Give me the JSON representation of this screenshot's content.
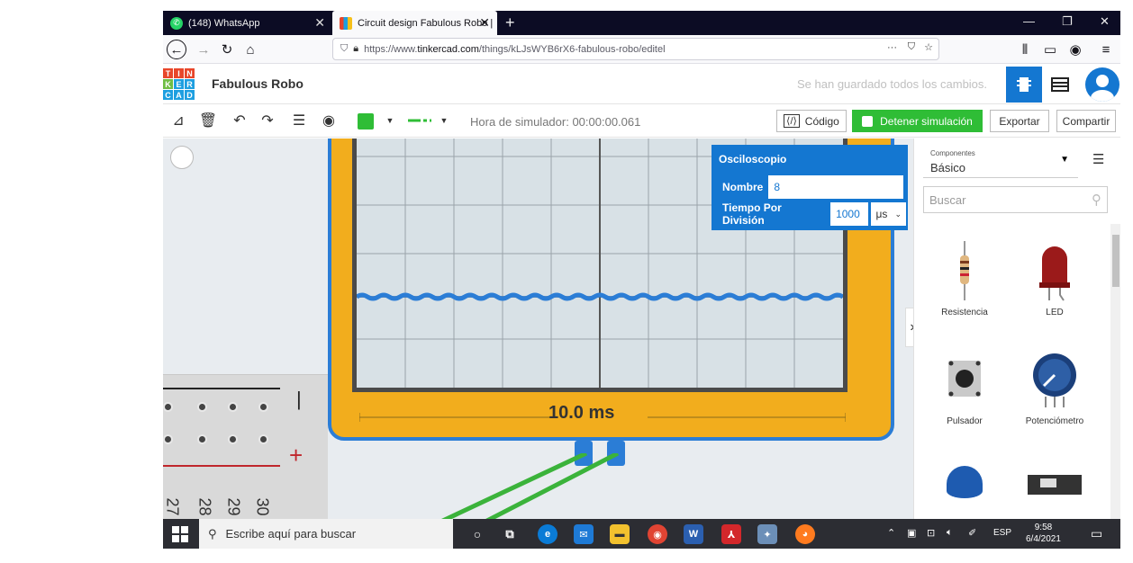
{
  "browser": {
    "tabs": [
      {
        "title": "(148) WhatsApp",
        "active": false
      },
      {
        "title": "Circuit design Fabulous Robo |",
        "active": true
      }
    ],
    "url_prefix": "https://www.",
    "url_domain": "tinkercad.com",
    "url_path": "/things/kLJsWYB6rX6-fabulous-robo/editel",
    "url_dots": "···"
  },
  "app": {
    "logo_letters": [
      "T",
      "I",
      "N",
      "K",
      "E",
      "R",
      "C",
      "A",
      "D"
    ],
    "design_title": "Fabulous Robo",
    "save_status": "Se han guardado todos los cambios."
  },
  "toolbar": {
    "sim_time": "Hora de simulador: 00:00:00.061",
    "code_label": "Código",
    "stop_sim_label": "Detener simulación",
    "export_label": "Exportar",
    "share_label": "Compartir",
    "color": "#2fbd36"
  },
  "oscilloscope": {
    "time_label": "10.0 ms"
  },
  "breadboard": {
    "row_labels": [
      "27",
      "28",
      "29",
      "30"
    ],
    "minus": "|",
    "plus": "+"
  },
  "properties": {
    "title": "Osciloscopio",
    "name_label": "Nombre",
    "name_value": "8",
    "time_label": "Tiempo Por División",
    "time_value": "1000",
    "time_unit": "μs"
  },
  "components": {
    "select_label": "Componentes",
    "select_value": "Básico",
    "search_placeholder": "Buscar",
    "items": [
      {
        "name": "Resistencia"
      },
      {
        "name": "LED"
      },
      {
        "name": "Pulsador"
      },
      {
        "name": "Potenciómetro"
      }
    ]
  },
  "taskbar": {
    "search_placeholder": "Escribe aquí para buscar",
    "language": "ESP",
    "time": "9:58",
    "date": "6/4/2021"
  },
  "colors": {
    "tinkercad_blue": "#1477d1",
    "sim_green": "#2fbd36",
    "osc_yellow": "#f2ad1d",
    "signal_blue": "#2b7dd6"
  }
}
